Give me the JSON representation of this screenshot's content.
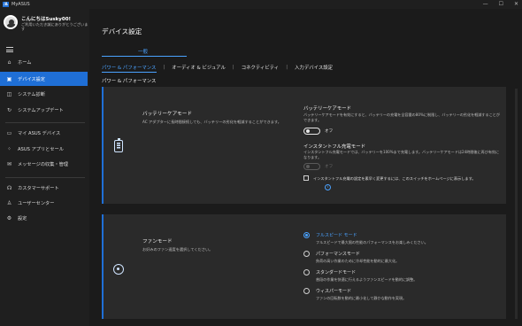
{
  "titlebar": {
    "logo": "/A",
    "app_title": "MyASUS",
    "minimize": "—",
    "maximize": "☐",
    "close": "✕"
  },
  "profile": {
    "greeting": "こんにちはSusky00!",
    "subtext": "ご利用いただき誠にありがとうございます"
  },
  "sidebar": {
    "items": [
      {
        "label": "ホーム",
        "icon": "home-icon"
      },
      {
        "label": "デバイス設定",
        "icon": "device-settings-icon"
      },
      {
        "label": "システム診断",
        "icon": "diagnostics-icon"
      },
      {
        "label": "システムアップデート",
        "icon": "update-icon"
      },
      {
        "label": "マイ ASUS デバイス",
        "icon": "devices-icon"
      },
      {
        "label": "ASUS アプリとセール",
        "icon": "apps-icon"
      },
      {
        "label": "メッセージの収集・管理",
        "icon": "message-icon"
      },
      {
        "label": "カスタマーサポート",
        "icon": "support-icon"
      },
      {
        "label": "ユーザーセンター",
        "icon": "user-icon"
      },
      {
        "label": "設定",
        "icon": "gear-icon"
      }
    ]
  },
  "main": {
    "title": "デバイス設定",
    "tab_general": "一般",
    "subtabs": [
      "パワー & パフォーマンス",
      "オーディオ & ビジュアル",
      "コネクティビティ",
      "入力デバイス設定"
    ],
    "separator": "|",
    "section_title": "パワー & パフォーマンス"
  },
  "battery_card": {
    "title": "バッテリーケアモード",
    "description": "AC アダプターに長時間接続しても、バッテリーの劣化を軽減することができます。",
    "care_mode_title": "バッテリーケアモード",
    "care_mode_desc": "バッテリーケアモードを有効にすると、バッテリーの充電を全容量の80%に制限し、バッテリーの劣化を軽減することができます。",
    "care_mode_state": "オフ",
    "instant_title": "インスタントフル充電モード",
    "instant_desc": "インスタントフル充電モードでは、バッテリーを100%まで充電します。バッテリーケアモードは24時間後に再び有効になります。",
    "instant_state": "オフ",
    "checkbox_label": "インスタントフル充電の設定を素早く変更するには、このスイッチをホームページに表示します。",
    "info": "i"
  },
  "fan_card": {
    "title": "ファンモード",
    "description": "お好みのファン速度を選択してください。",
    "options": [
      {
        "label": "フルスピード モード",
        "desc": "フルスピードで最大限の性能のパフォーマンスをお楽しみください。",
        "selected": true
      },
      {
        "label": "パフォーマンスモード",
        "desc": "負荷の高い作業のために冷却性能を動的に最大化。",
        "selected": false
      },
      {
        "label": "スタンダードモード",
        "desc": "普段の作業を快適に行えるようファンスピードを動的に調整。",
        "selected": false
      },
      {
        "label": "ウィスパーモード",
        "desc": "ファンの回転数を動的に最小化して静かな動作を実現。",
        "selected": false
      }
    ]
  },
  "colors": {
    "accent": "#1f6fd6",
    "accent_text": "#4aa2ff",
    "background": "#1b1b1b",
    "card": "#2a2a2a"
  }
}
